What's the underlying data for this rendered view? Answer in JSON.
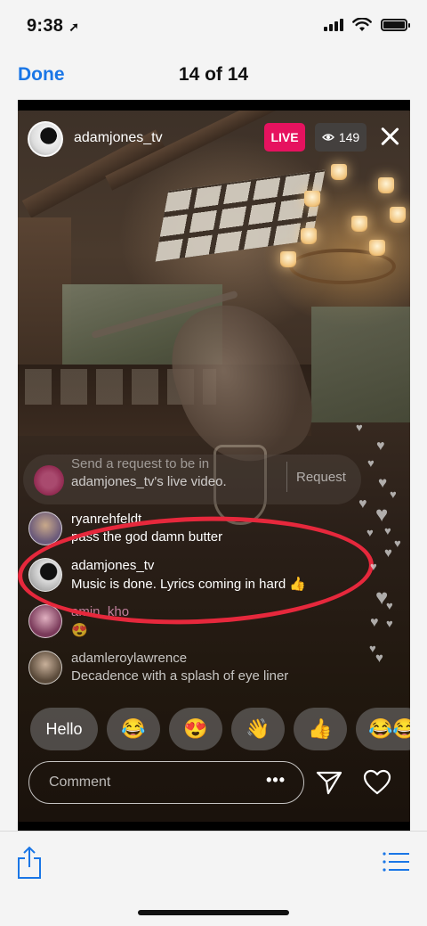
{
  "status_bar": {
    "time": "9:38",
    "location_glyph": "➚"
  },
  "nav": {
    "done_label": "Done",
    "title": "14 of 14"
  },
  "live": {
    "username": "adamjones_tv",
    "live_label": "LIVE",
    "viewer_count": "149",
    "request": {
      "line1": "Send a request to be in",
      "line2": "adamjones_tv's live video.",
      "button_label": "Request"
    },
    "comments": [
      {
        "user": "ryanrehfeldt",
        "text": "pass the god damn butter",
        "avatar_color": "#6b5a7a"
      },
      {
        "user": "adamjones_tv",
        "text": "Music is done. Lyrics coming in hard 👍",
        "avatar_color": "#222222"
      },
      {
        "user": "amin_kho",
        "text": "😍",
        "avatar_color": "#7a3a5a"
      },
      {
        "user": "adamleroylawrence",
        "text": "Decadence with a splash of eye liner",
        "avatar_color": "#5a4a3a"
      }
    ],
    "quick_replies": [
      "Hello",
      "😂",
      "😍",
      "👋",
      "👍",
      "😂😂"
    ],
    "comment_placeholder": "Comment",
    "more_label": "•••"
  },
  "colors": {
    "ios_blue": "#1a76e6",
    "live_pink": "#e6125f",
    "highlight_red": "#e6283c"
  }
}
